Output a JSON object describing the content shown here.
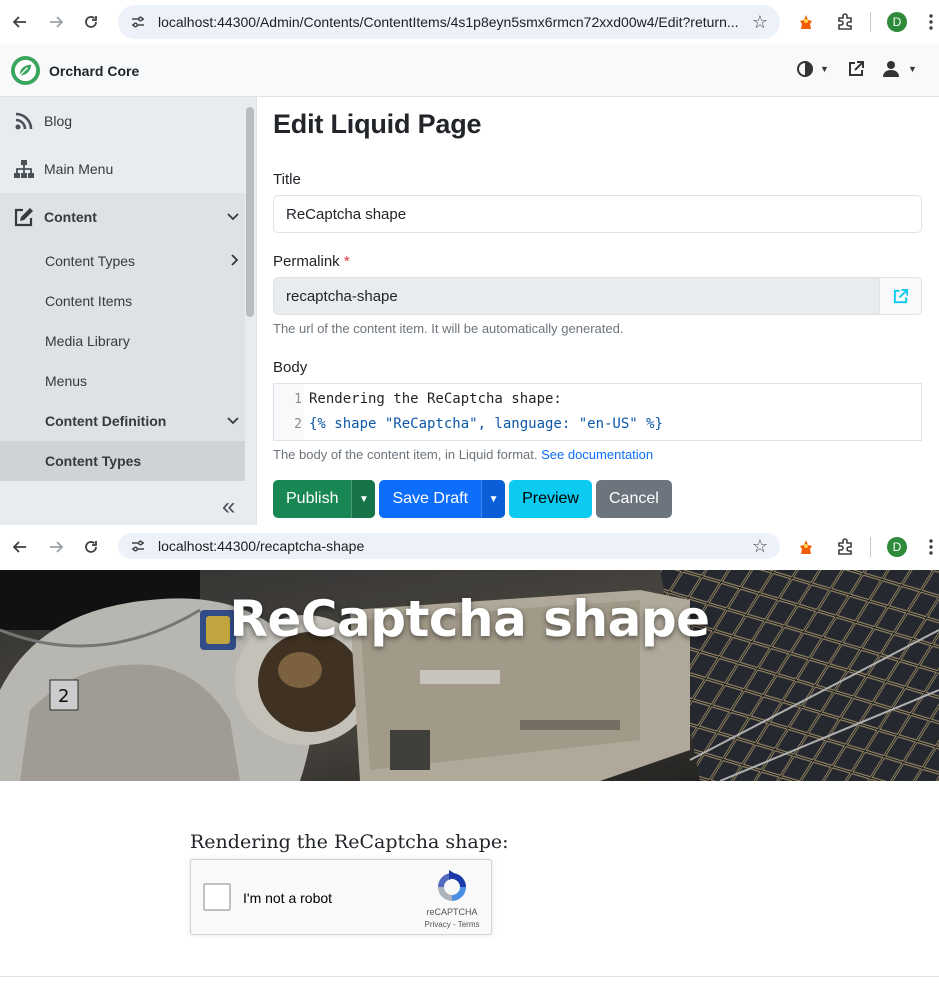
{
  "browser1": {
    "url": "localhost:44300/Admin/Contents/ContentItems/4s1p8eyn5smx6rmcn72xxd00w4/Edit?return...",
    "profile_initial": "D"
  },
  "admin": {
    "brand": "Orchard Core",
    "sidebar": {
      "items": [
        {
          "label": "Blog"
        },
        {
          "label": "Main Menu"
        },
        {
          "label": "Content"
        },
        {
          "label": "Content Types"
        },
        {
          "label": "Content Items"
        },
        {
          "label": "Media Library"
        },
        {
          "label": "Menus"
        },
        {
          "label": "Content Definition"
        },
        {
          "label": "Content Types"
        }
      ]
    },
    "page_title": "Edit Liquid Page",
    "title_field": {
      "label": "Title",
      "value": "ReCaptcha shape"
    },
    "permalink_field": {
      "label": "Permalink",
      "required_mark": "*",
      "value": "recaptcha-shape",
      "hint": "The url of the content item. It will be automatically generated."
    },
    "body_field": {
      "label": "Body",
      "lines": [
        {
          "num": "1",
          "text": "Rendering the ReCaptcha shape:"
        },
        {
          "num": "2",
          "text": "{% shape \"ReCaptcha\", language: \"en-US\" %}"
        }
      ],
      "hint": "The body of the content item, in Liquid format.",
      "hint_link": "See documentation"
    },
    "buttons": {
      "publish": "Publish",
      "save_draft": "Save Draft",
      "preview": "Preview",
      "cancel": "Cancel"
    }
  },
  "browser2": {
    "url": "localhost:44300/recaptcha-shape",
    "profile_initial": "D"
  },
  "site": {
    "hero_title": "ReCaptcha shape",
    "body_text": "Rendering the ReCaptcha shape:",
    "recaptcha": {
      "label": "I'm not a robot",
      "brand": "reCAPTCHA",
      "terms": "Privacy - Terms"
    }
  },
  "colors": {
    "success": "#198754",
    "primary": "#0d6efd",
    "info": "#0dcaf0",
    "secondary": "#6c757d",
    "sidebar_bg": "#e9ecef"
  }
}
